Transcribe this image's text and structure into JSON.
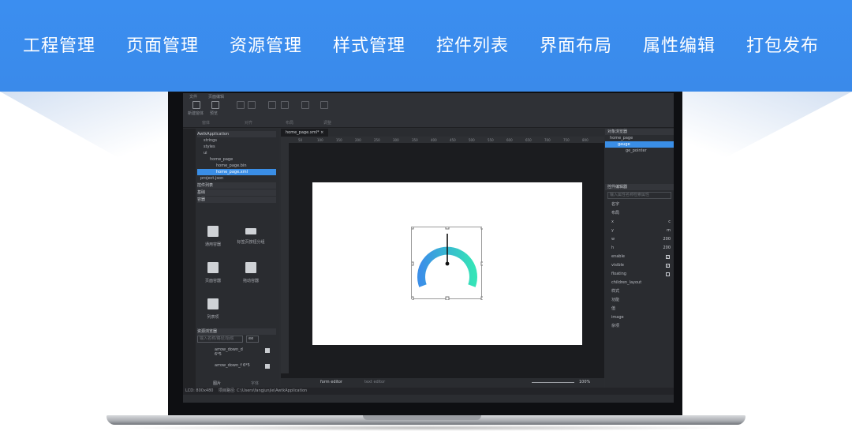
{
  "nav": {
    "items": [
      {
        "label": "工程管理"
      },
      {
        "label": "页面管理"
      },
      {
        "label": "资源管理"
      },
      {
        "label": "样式管理"
      },
      {
        "label": "控件列表"
      },
      {
        "label": "界面布局"
      },
      {
        "label": "属性编辑"
      },
      {
        "label": "打包发布"
      }
    ]
  },
  "app": {
    "menu": [
      "文件",
      "页面编辑"
    ],
    "toolbar": {
      "new_label": "新建窗体",
      "preview_label": "预览",
      "groups": [
        "窗体",
        "对齐",
        "布局",
        "调整"
      ]
    },
    "tree": {
      "root": "AwtkApplication",
      "items": [
        "strings",
        "styles",
        "ui",
        "home_page",
        "home_page.bin",
        "home_page.xml",
        "project.json"
      ],
      "selected": "home_page.xml"
    },
    "sections": [
      "控件列表",
      "基础",
      "容器"
    ],
    "widgets": [
      "通用容器",
      "标签页按钮分组",
      "页面容器",
      "拖动容器",
      "列表项"
    ],
    "resources": {
      "title": "资源浏览器",
      "search_placeholder": "输入名称/路径/后缀",
      "filter": "ee",
      "items": [
        "arrow_down_d 6*5",
        "arrow_down_f 6*5"
      ],
      "tabs": [
        "图片",
        "字体"
      ]
    },
    "editor": {
      "tab": "home_page.xml*",
      "ruler_marks": [
        "50",
        "100",
        "150",
        "200",
        "250",
        "300",
        "350",
        "400",
        "450",
        "500",
        "550",
        "600",
        "650",
        "700",
        "750",
        "800"
      ],
      "bottom_tabs": [
        "form editor",
        "text editor"
      ],
      "zoom": "100%"
    },
    "objects": {
      "title": "对象浏览器",
      "items": [
        "home_page",
        "gauge",
        "ge_pointer"
      ],
      "selected": "gauge"
    },
    "props": {
      "title": "控件编辑器",
      "search_placeholder": "输入属性名称检索属性",
      "groups": [
        "名字",
        "布局"
      ],
      "fields": [
        {
          "name": "x",
          "value": "c"
        },
        {
          "name": "y",
          "value": "m"
        },
        {
          "name": "w",
          "value": "200"
        },
        {
          "name": "h",
          "value": "200"
        }
      ],
      "checks": [
        {
          "name": "enable",
          "checked": true
        },
        {
          "name": "visible",
          "checked": true
        },
        {
          "name": "floating",
          "checked": false
        }
      ],
      "children_layout": "children_layout",
      "more_groups": [
        "样式",
        "功能",
        "值",
        "image",
        "杂项"
      ]
    },
    "status": {
      "lcd_label": "LCD:",
      "lcd": "800x480",
      "path_label": "项目路径:",
      "path": "C:\\Users\\fangjunjie\\AwtkApplication"
    }
  },
  "colors": {
    "banner": "#3a8aea",
    "accent": "#3a8ee6",
    "gauge_start": "#3b8fe8",
    "gauge_end": "#35e3b8"
  }
}
